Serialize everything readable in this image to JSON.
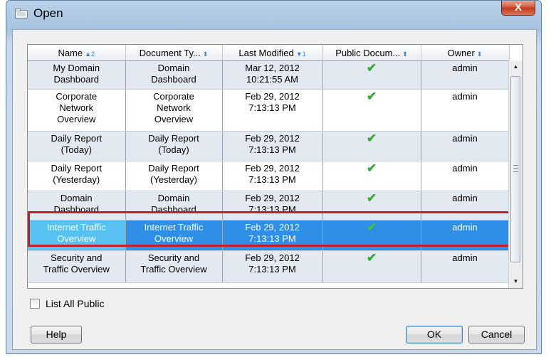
{
  "window": {
    "title": "Open",
    "close_label": "X"
  },
  "table": {
    "headers": [
      {
        "label": "Name",
        "sort": "▲2"
      },
      {
        "label": "Document Ty...",
        "sort": "⬍"
      },
      {
        "label": "Last Modified",
        "sort": "▼1"
      },
      {
        "label": "Public Docum...",
        "sort": "⬍"
      },
      {
        "label": "Owner",
        "sort": "⬍"
      }
    ],
    "rows": [
      {
        "name": [
          "My Domain",
          "Dashboard"
        ],
        "type": [
          "Domain",
          "Dashboard"
        ],
        "modified": [
          "Mar 12, 2012",
          "10:21:55 AM"
        ],
        "public": "✔",
        "owner": "admin"
      },
      {
        "name": [
          "Corporate",
          "Network",
          "Overview"
        ],
        "type": [
          "Corporate",
          "Network",
          "Overview"
        ],
        "modified": [
          "Feb 29, 2012",
          "7:13:13 PM"
        ],
        "public": "✔",
        "owner": "admin"
      },
      {
        "name": [
          "Daily Report",
          "(Today)"
        ],
        "type": [
          "Daily Report",
          "(Today)"
        ],
        "modified": [
          "Feb 29, 2012",
          "7:13:13 PM"
        ],
        "public": "✔",
        "owner": "admin"
      },
      {
        "name": [
          "Daily Report",
          "(Yesterday)"
        ],
        "type": [
          "Daily Report",
          "(Yesterday)"
        ],
        "modified": [
          "Feb 29, 2012",
          "7:13:13 PM"
        ],
        "public": "✔",
        "owner": "admin"
      },
      {
        "name": [
          "Domain",
          "Dashboard"
        ],
        "type": [
          "Domain",
          "Dashboard"
        ],
        "modified": [
          "Feb 29, 2012",
          "7:13:13 PM"
        ],
        "public": "✔",
        "owner": "admin"
      },
      {
        "name": [
          "Internet Traffic",
          "Overview"
        ],
        "type": [
          "Internet Traffic",
          "Overview"
        ],
        "modified": [
          "Feb 29, 2012",
          "7:13:13 PM"
        ],
        "public": "✔",
        "owner": "admin"
      },
      {
        "name": [
          "Security and",
          "Traffic Overview"
        ],
        "type": [
          "Security and",
          "Traffic Overview"
        ],
        "modified": [
          "Feb 29, 2012",
          "7:13:13 PM"
        ],
        "public": "✔",
        "owner": "admin"
      }
    ]
  },
  "options": {
    "list_all_public_label": "List All Public",
    "list_all_public_checked": false
  },
  "buttons": {
    "help": "Help",
    "ok": "OK",
    "cancel": "Cancel"
  },
  "colors": {
    "selection": "#2f8ee5",
    "highlight_outline": "#c21f2a",
    "check": "#3aa93a"
  }
}
